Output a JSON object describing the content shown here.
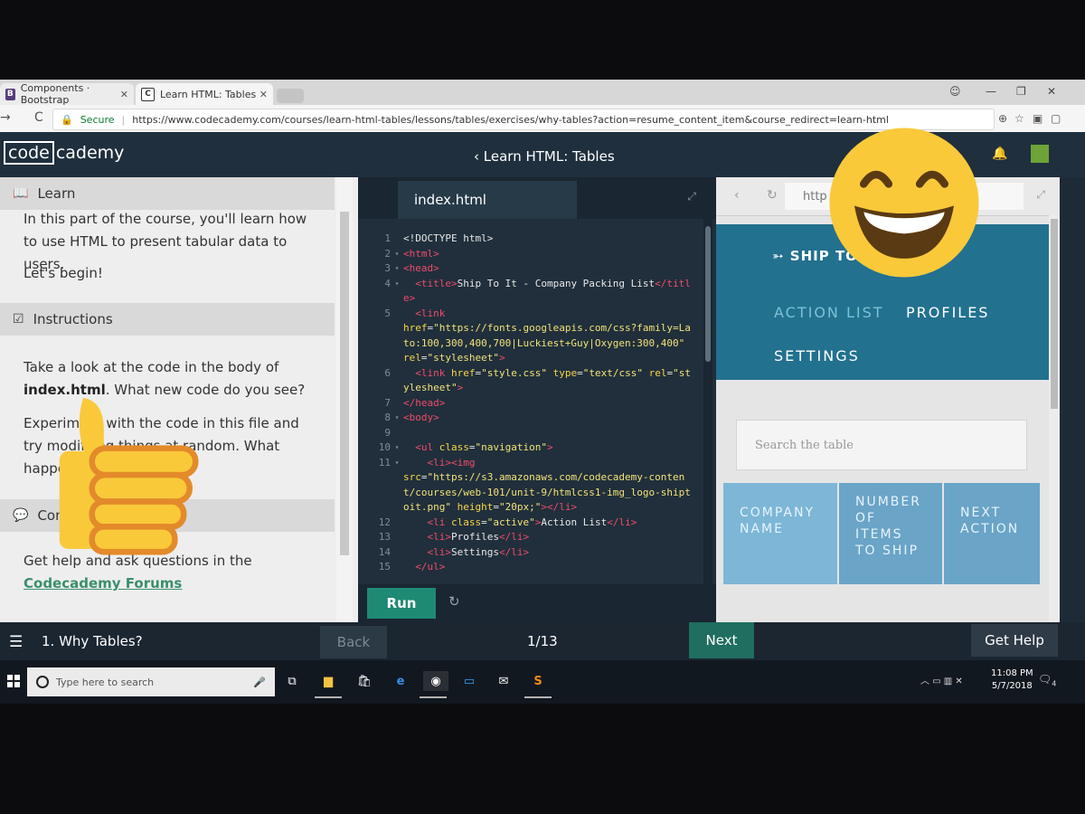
{
  "browser": {
    "tabs": [
      {
        "favicon": "B",
        "title": "Components · Bootstrap"
      },
      {
        "favicon": "C",
        "title": "Learn HTML: Tables | Cod"
      }
    ],
    "secure_label": "Secure",
    "url": "https://www.codecademy.com/courses/learn-html-tables/lessons/tables/exercises/why-tables?action=resume_content_item&course_redirect=learn-html"
  },
  "header": {
    "logo_box": "code",
    "logo_rest": "cademy",
    "course_title": "Learn HTML: Tables"
  },
  "learn": {
    "heading": "Learn",
    "para1": "In this part of the course, you'll learn how to use HTML to present tabular data to users.",
    "para2": "Let's begin!",
    "instructions_heading": "Instructions",
    "instr_pre": "Take a look at the code in the body of ",
    "instr_bold": "index.html",
    "instr_post": ". What new code do you see?",
    "instr2": "Experiment with the code in this file and try modifying things at random. What happens?",
    "community_heading": "Community Forums",
    "community_text": "Get help and ask questions in the",
    "community_link": "Codecademy Forums"
  },
  "editor": {
    "filename": "index.html",
    "run_label": "Run"
  },
  "preview": {
    "url_text": "http",
    "brand": "SHIP TO IT",
    "nav_items": [
      "ACTION LIST",
      "PROFILES",
      "SETTINGS"
    ],
    "search_placeholder": "Search the table",
    "headers": [
      "COMPANY NAME",
      "NUMBER OF ITEMS TO SHIP",
      "NEXT ACTION"
    ]
  },
  "bottom": {
    "lesson": "1. Why Tables?",
    "back_label": "Back",
    "progress": "1/13",
    "next_label": "Next",
    "help_label": "Get Help"
  },
  "taskbar": {
    "search_placeholder": "Type here to search",
    "time": "11:08 PM",
    "date": "5/7/2018",
    "notifications": "4"
  },
  "colors": {
    "accent": "#1f8a74",
    "site_nav": "#22718f",
    "table_header": "#7db6d7"
  }
}
